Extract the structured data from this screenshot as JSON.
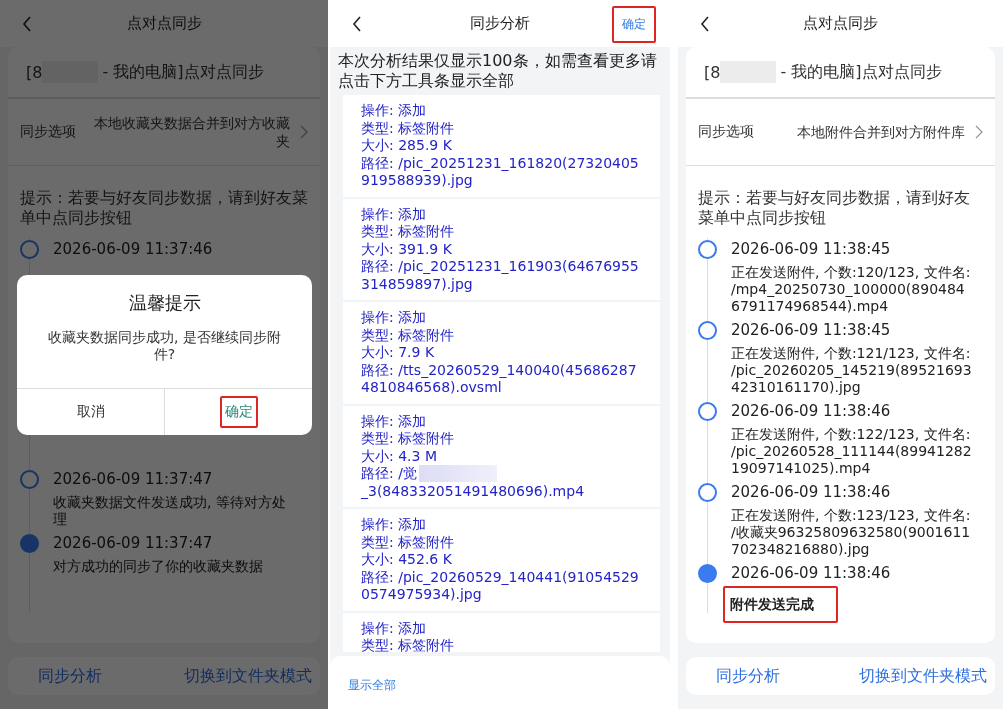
{
  "screens": [
    {
      "kind": "sync",
      "title": "点对点同步",
      "device": {
        "prefix": "[8",
        "suffix": "- 我的电脑]点对点同步"
      },
      "option_label": "同步选项",
      "option_value": "本地收藏夹数据合并到对方收藏夹",
      "hint": "提示：若要与好友同步数据，请到好友菜单中点同步按钮",
      "timeline": [
        {
          "time": "2026-06-09  11:37:46",
          "filled": false
        },
        {
          "time": "2026-06-09  11:37:47",
          "message": "收藏夹数据文件发送成功, 等待对方处理",
          "filled": false
        },
        {
          "time": "2026-06-09  11:37:47",
          "message": "对方成功的同步了你的收藏夹数据",
          "filled": true
        }
      ],
      "footer": [
        "同步分析",
        "切换到文件夹模式"
      ],
      "dialog": {
        "title": "温馨提示",
        "message": "收藏夹数据同步成功, 是否继续同步附件?",
        "buttons": [
          {
            "label": "取消",
            "highlighted": false
          },
          {
            "label": "确定",
            "highlighted": true
          }
        ]
      }
    },
    {
      "kind": "analysis",
      "title": "同步分析",
      "action": {
        "label": "确定",
        "highlighted": true
      },
      "notice": "本次分析结果仅显示100条，如需查看更多请点击下方工具条显示全部",
      "entries": [
        {
          "op": "操作: 添加",
          "type": "类型: 标签附件",
          "size": "大小: 285.9 K",
          "path": "路径: /pic_20251231_161820(27320405919588939).jpg"
        },
        {
          "op": "操作: 添加",
          "type": "类型: 标签附件",
          "size": "大小: 391.9 K",
          "path": "路径: /pic_20251231_161903(64676955314859897).jpg"
        },
        {
          "op": "操作: 添加",
          "type": "类型: 标签附件",
          "size": "大小: 7.9 K",
          "path": "路径: /tts_20260529_140040(456862874810846568).ovsml"
        },
        {
          "op": "操作: 添加",
          "type": "类型: 标签附件",
          "size": "大小: 4.3 M",
          "path": "路径: /觉",
          "path_end": "_3(848332051491480696).mp4"
        },
        {
          "op": "操作: 添加",
          "type": "类型: 标签附件",
          "size": "大小: 452.6 K",
          "path": "路径: /pic_20260529_140441(910545290574975934).jpg"
        },
        {
          "op": "操作: 添加",
          "type": "类型: 标签附件"
        }
      ],
      "footer_link": "显示全部"
    },
    {
      "kind": "sync",
      "title": "点对点同步",
      "device": {
        "prefix": "[8",
        "suffix": "- 我的电脑]点对点同步"
      },
      "option_label": "同步选项",
      "option_value": "本地附件合并到对方附件库",
      "hint": "提示：若要与好友同步数据，请到好友菜单中点同步按钮",
      "timeline": [
        {
          "time": "2026-06-09  11:38:45",
          "message": "正在发送附件, 个数:120/123, 文件名: /mp4_20250730_100000(8904846791174968544).mp4",
          "filled": false
        },
        {
          "time": "2026-06-09  11:38:45",
          "message": "正在发送附件, 个数:121/123, 文件名: /pic_20260205_145219(8952169342310161170).jpg",
          "filled": false
        },
        {
          "time": "2026-06-09  11:38:46",
          "message": "正在发送附件, 个数:122/123, 文件名: /pic_20260528_111144(8994128219097141025).mp4",
          "filled": false
        },
        {
          "time": "2026-06-09  11:38:46",
          "message": "正在发送附件, 个数:123/123, 文件名: /收藏夹96325809632580(9001611702348216880).jpg",
          "filled": false
        },
        {
          "time": "2026-06-09  11:38:46",
          "message": "附件发送完成",
          "filled": true,
          "highlighted": true
        }
      ],
      "footer": [
        "同步分析",
        "切换到文件夹模式"
      ]
    }
  ]
}
